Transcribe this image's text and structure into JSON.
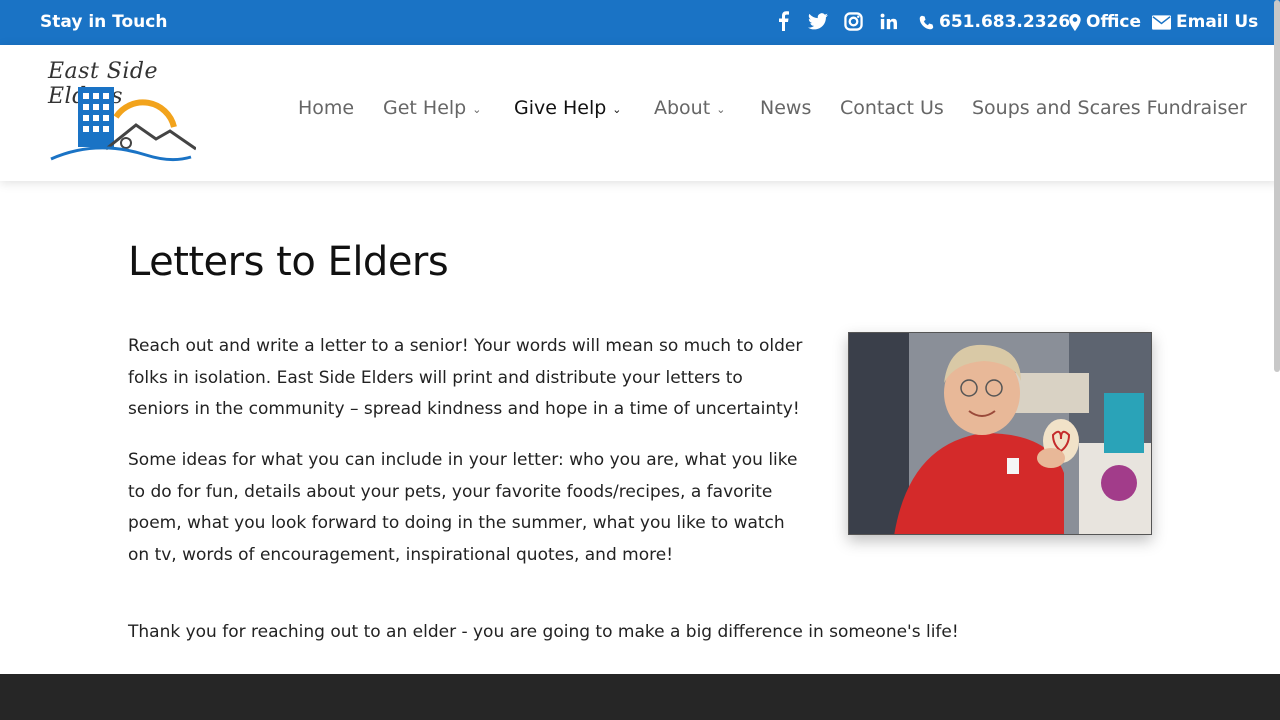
{
  "topbar": {
    "tagline": "Stay in Touch",
    "social_icons": [
      "facebook-icon",
      "twitter-icon",
      "instagram-icon",
      "linkedin-icon"
    ],
    "phone": "651.683.2326",
    "office": "Office",
    "email": "Email Us"
  },
  "logo": {
    "text": "East Side Elders"
  },
  "nav": {
    "items": [
      {
        "label": "Home"
      },
      {
        "label": "Get Help"
      },
      {
        "label": "Give Help"
      },
      {
        "label": "About"
      },
      {
        "label": "News"
      },
      {
        "label": "Contact Us"
      },
      {
        "label": "Soups and Scares Fundraiser"
      }
    ]
  },
  "main": {
    "title": "Letters to Elders",
    "p1": "Reach out and write a letter to a senior!  Your words will mean so much to older folks in isolation.  East Side Elders will print and distribute your letters to seniors in the community – spread kindness and hope in a time of uncertainty!",
    "p2": "Some ideas for what you can include in your letter:  who you are, what you like to do for fun, details about your pets, your favorite foods/recipes, a favorite poem, what you look forward to doing in the summer, what you like to watch on tv, words of encouragement, inspirational quotes, and more!",
    "p3": "Thank you for reaching out to an elder - you are going to make a big difference in someone's life!"
  },
  "colors": {
    "topbar": "#1a73c5",
    "footer": "#262626",
    "logo_blue": "#1a73c5",
    "logo_sun": "#f2a31c"
  }
}
